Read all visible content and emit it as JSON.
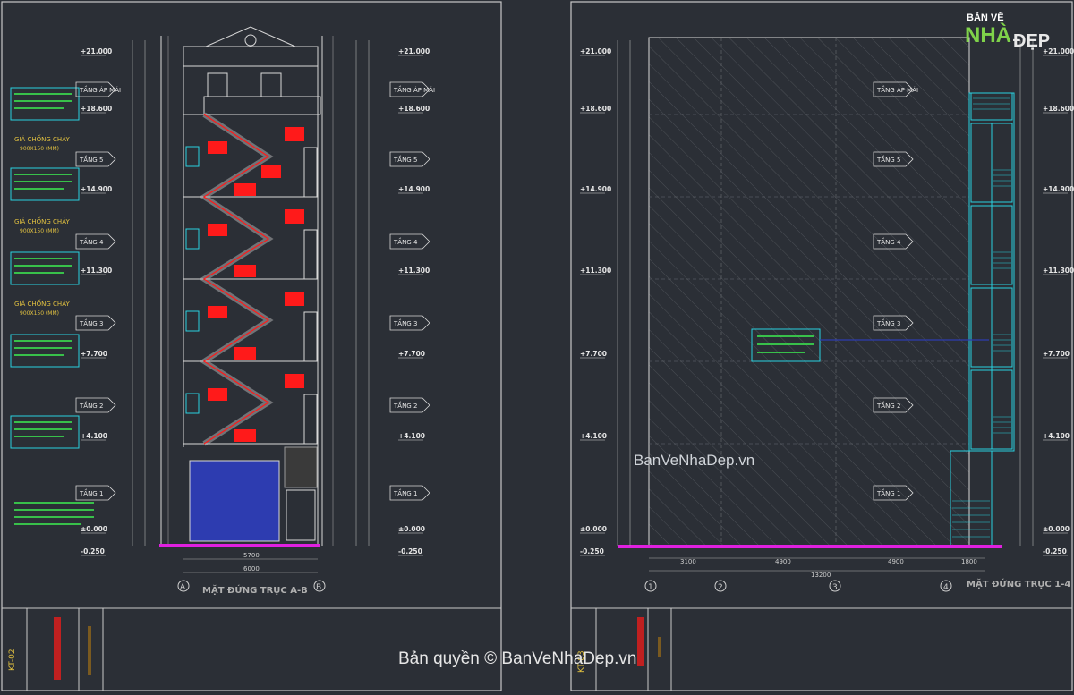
{
  "left_sheet": {
    "title": "MẶT ĐỨNG TRỤC A-B",
    "axis_left": "A",
    "axis_right": "B",
    "stamp": "KT-02",
    "floors": [
      "TẦNG ÁP MÁI",
      "TẦNG 5",
      "TẦNG 4",
      "TẦNG 3",
      "TẦNG 2",
      "TẦNG 1"
    ],
    "levels_left": [
      "+21.000",
      "+18.600",
      "+14.900",
      "+11.300",
      "+7.700",
      "+4.100",
      "±0.000",
      "-0.250"
    ],
    "levels_right": [
      "+21.000",
      "+18.600",
      "+14.900",
      "+11.300",
      "+7.700",
      "+4.100",
      "±0.000",
      "-0.250"
    ],
    "note_fire": "GIÁ CHỐNG CHÁY",
    "note_fire_size": "900X150 (MM)",
    "dims_bottom": [
      "5700",
      "6000"
    ]
  },
  "right_sheet": {
    "title": "MẶT ĐỨNG TRỤC 1-4",
    "axes": [
      "1",
      "2",
      "3",
      "4"
    ],
    "stamp": "KT-03",
    "floors": [
      "TẦNG ÁP MÁI",
      "TẦNG 5",
      "TẦNG 4",
      "TẦNG 3",
      "TẦNG 2",
      "TẦNG 1"
    ],
    "levels_left": [
      "+21.000",
      "+18.600",
      "+14.900",
      "+11.300",
      "+7.700",
      "+4.100",
      "±0.000",
      "-0.250"
    ],
    "levels_right": [
      "+21.000",
      "+18.600",
      "+14.900",
      "+11.300",
      "+7.700",
      "+4.100",
      "±0.000",
      "-0.250"
    ],
    "dims_bottom": [
      "3100",
      "4900",
      "4900",
      "1800"
    ],
    "dim_total": "13200"
  },
  "watermark_center": "BanVeNhaDep.vn",
  "watermark_bottom": "Bản quyền © BanVeNhaDep.vn",
  "logo": {
    "line1": "BẢN VẼ",
    "line2": "NHÀ",
    "line3": "ĐẸP"
  },
  "colors": {
    "background": "#2b2f36",
    "line_white": "#d8d8d8",
    "stair_red": "#ff1a1a",
    "frame_cyan": "#2ad2e0",
    "note_green": "#3cf050",
    "ground_magenta": "#e020e0",
    "window_blue": "#2d3cb0",
    "note_yellow": "#e0c040"
  }
}
